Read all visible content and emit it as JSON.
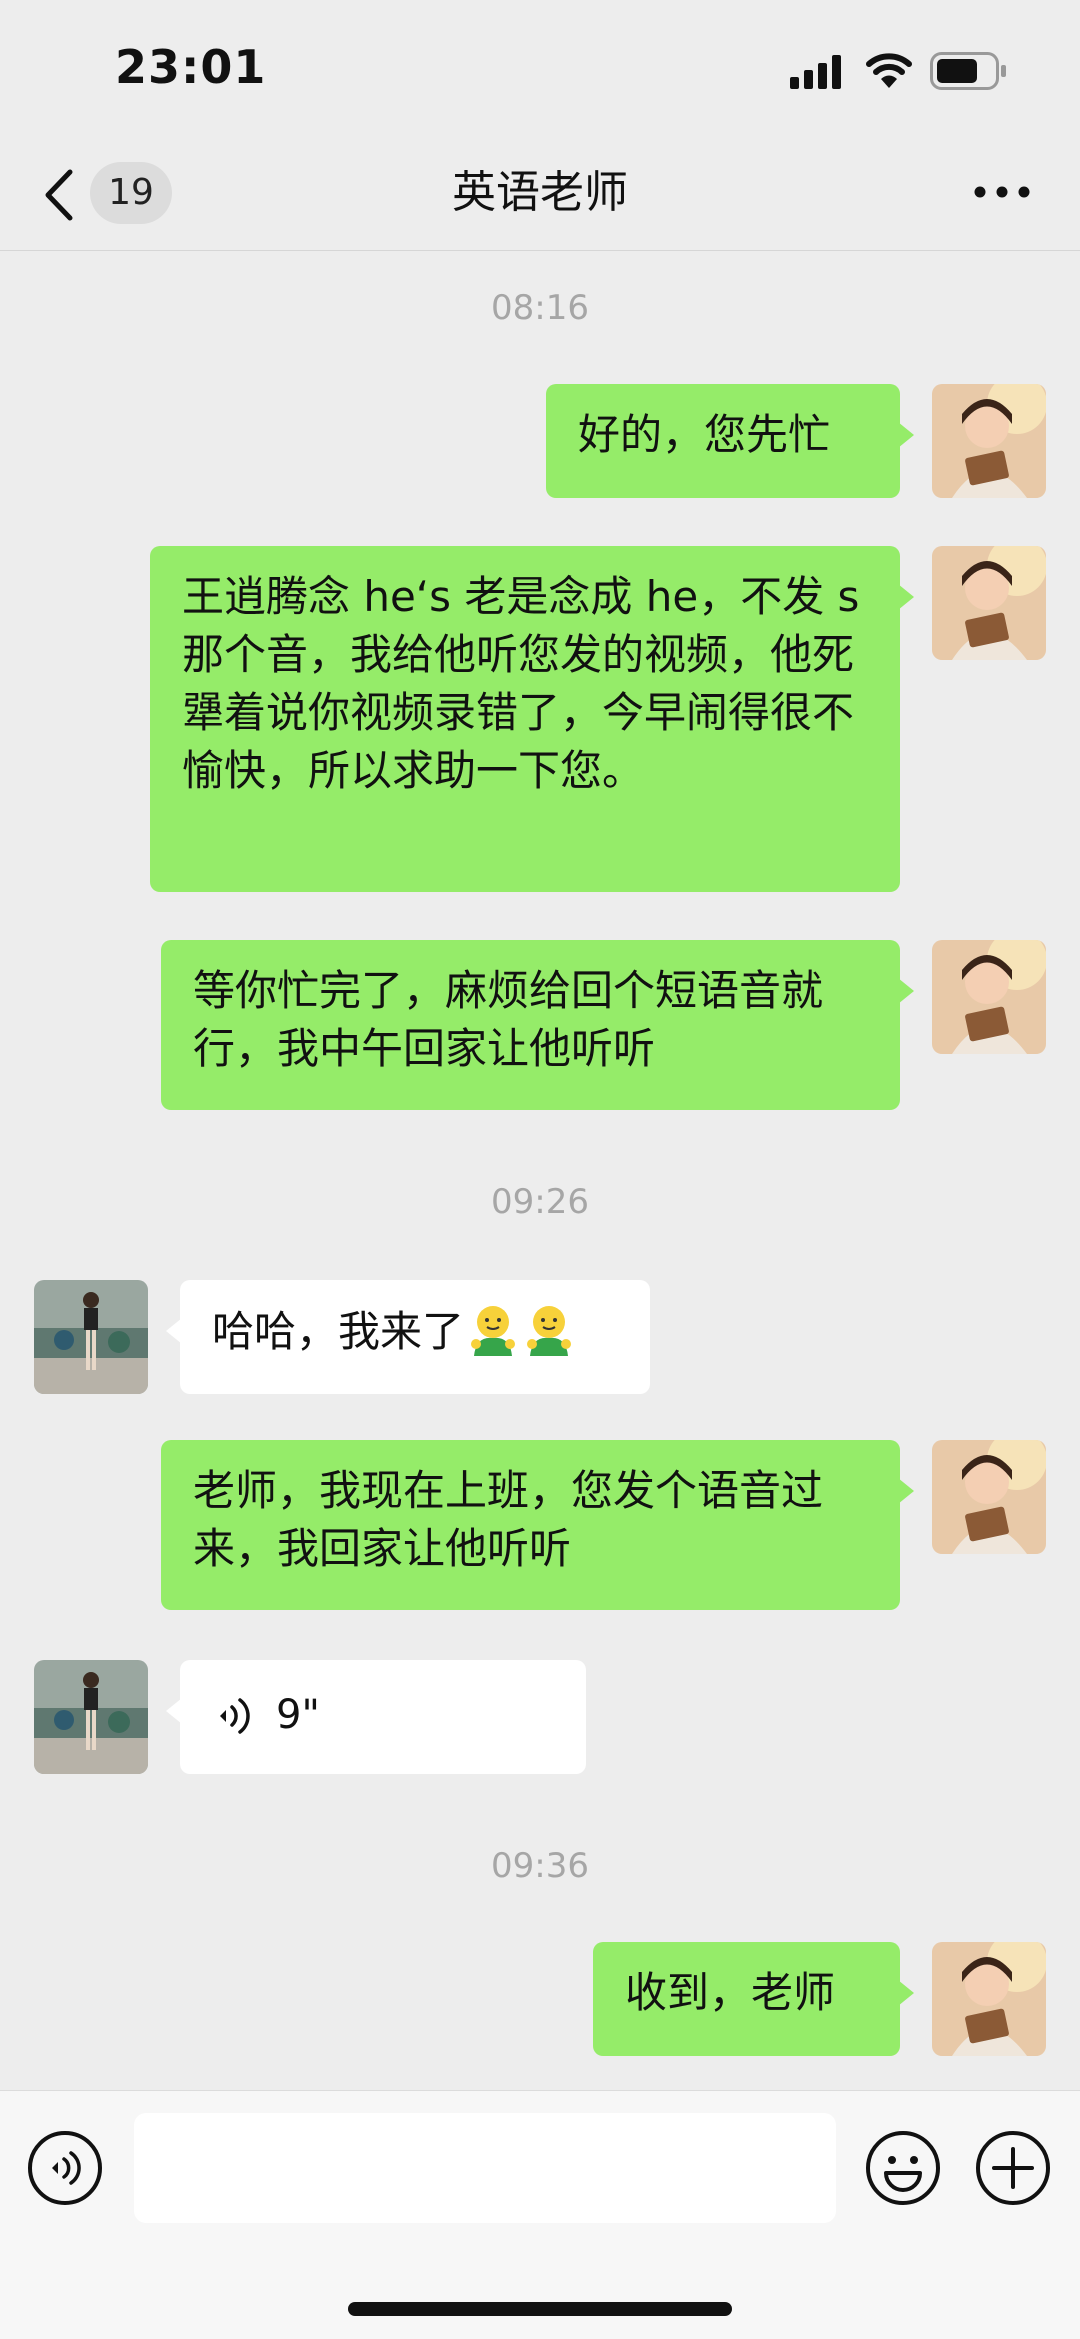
{
  "status_bar": {
    "time": "23:01"
  },
  "nav": {
    "unread_count": "19",
    "title": "英语老师"
  },
  "timestamps": [
    "08:16",
    "09:26",
    "09:36"
  ],
  "messages": [
    {
      "sender": "me",
      "text": "好的，您先忙"
    },
    {
      "sender": "me",
      "text": "王逍腾念 he‘s 老是念成 he，不发 s 那个音，我给他听您发的视频，他死犟着说你视频录错了，今早闹得很不愉快，所以求助一下您。"
    },
    {
      "sender": "me",
      "text": "等你忙完了，麻烦给回个短语音就行，我中午回家让他听听"
    },
    {
      "sender": "teacher",
      "text": "哈哈，我来了"
    },
    {
      "sender": "me",
      "text": "老师，我现在上班，您发个语音过来，我回家让他听听"
    },
    {
      "sender": "teacher",
      "type": "voice",
      "duration": "9\""
    },
    {
      "sender": "me",
      "text": "收到，老师"
    }
  ],
  "colors": {
    "my_bubble": "#95ec69",
    "their_bubble": "#ffffff",
    "background": "#ededed"
  }
}
